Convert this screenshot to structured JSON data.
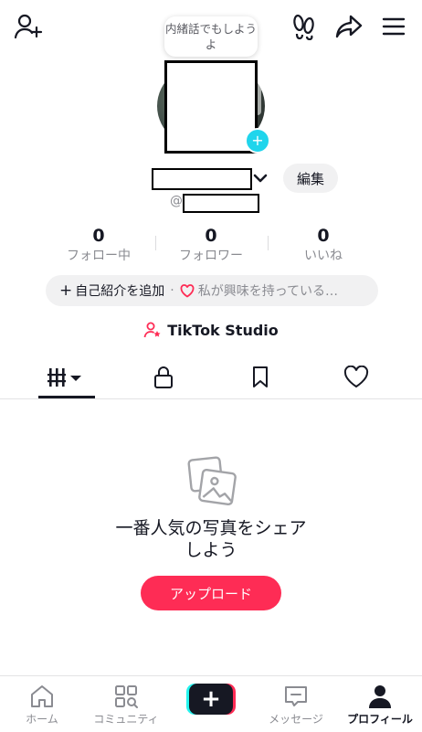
{
  "header": {
    "bubble_text": "内緒話でもしようよ"
  },
  "profile": {
    "edit_label": "編集",
    "handle_prefix": "@",
    "stats": [
      {
        "value": "0",
        "label": "フォロー中"
      },
      {
        "value": "0",
        "label": "フォロワー"
      },
      {
        "value": "0",
        "label": "いいね"
      }
    ],
    "bio": {
      "add_label": "自己紹介を追加",
      "separator": "·",
      "interest_label": "私が興味を持っている…"
    },
    "studio_label": "TikTok Studio"
  },
  "tabs": [
    "videos",
    "private",
    "saved",
    "liked"
  ],
  "empty_state": {
    "title_line1": "一番人気の写真をシェア",
    "title_line2": "しよう",
    "upload_label": "アップロード"
  },
  "bottom_nav": {
    "home": "ホーム",
    "community": "コミュニティ",
    "messages": "メッセージ",
    "profile": "プロフィール"
  },
  "colors": {
    "accent": "#fe2c55",
    "cyan": "#25f4ee",
    "text": "#161823",
    "muted": "#8a8b91"
  }
}
